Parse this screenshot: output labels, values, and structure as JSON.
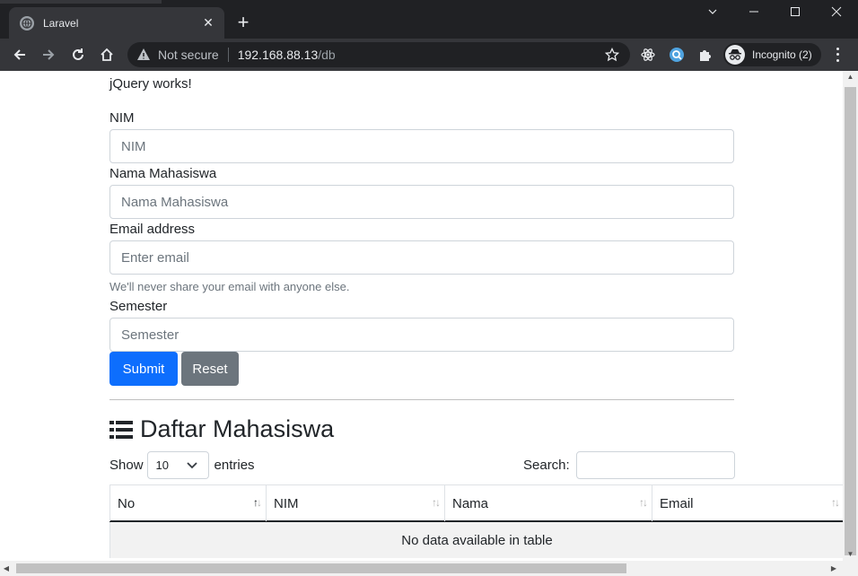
{
  "browser": {
    "tab_title": "Laravel",
    "new_tab": "+",
    "window_controls": [
      "chevron-down-icon",
      "minimize-icon",
      "maximize-icon",
      "close-icon"
    ],
    "address": {
      "security_label": "Not secure",
      "host": "192.168.88.13",
      "path": "/db"
    },
    "incognito_label": "Incognito (2)"
  },
  "page": {
    "jquery_message": "jQuery works!",
    "form": {
      "nim_label": "NIM",
      "nim_placeholder": "NIM",
      "nama_label": "Nama Mahasiswa",
      "nama_placeholder": "Nama Mahasiswa",
      "email_label": "Email address",
      "email_placeholder": "Enter email",
      "email_help": "We'll never share your email with anyone else.",
      "semester_label": "Semester",
      "semester_placeholder": "Semester",
      "submit_label": "Submit",
      "reset_label": "Reset"
    },
    "section_title": "Daftar Mahasiswa",
    "datatable": {
      "show_label": "Show",
      "entries_value": "10",
      "entries_label": "entries",
      "search_label": "Search:",
      "columns": [
        "No",
        "NIM",
        "Nama",
        "Email"
      ],
      "empty_message": "No data available in table"
    }
  },
  "colors": {
    "primary": "#0d6efd",
    "secondary": "#6c757d",
    "chrome_dark": "#202124",
    "chrome_toolbar": "#35363a"
  }
}
